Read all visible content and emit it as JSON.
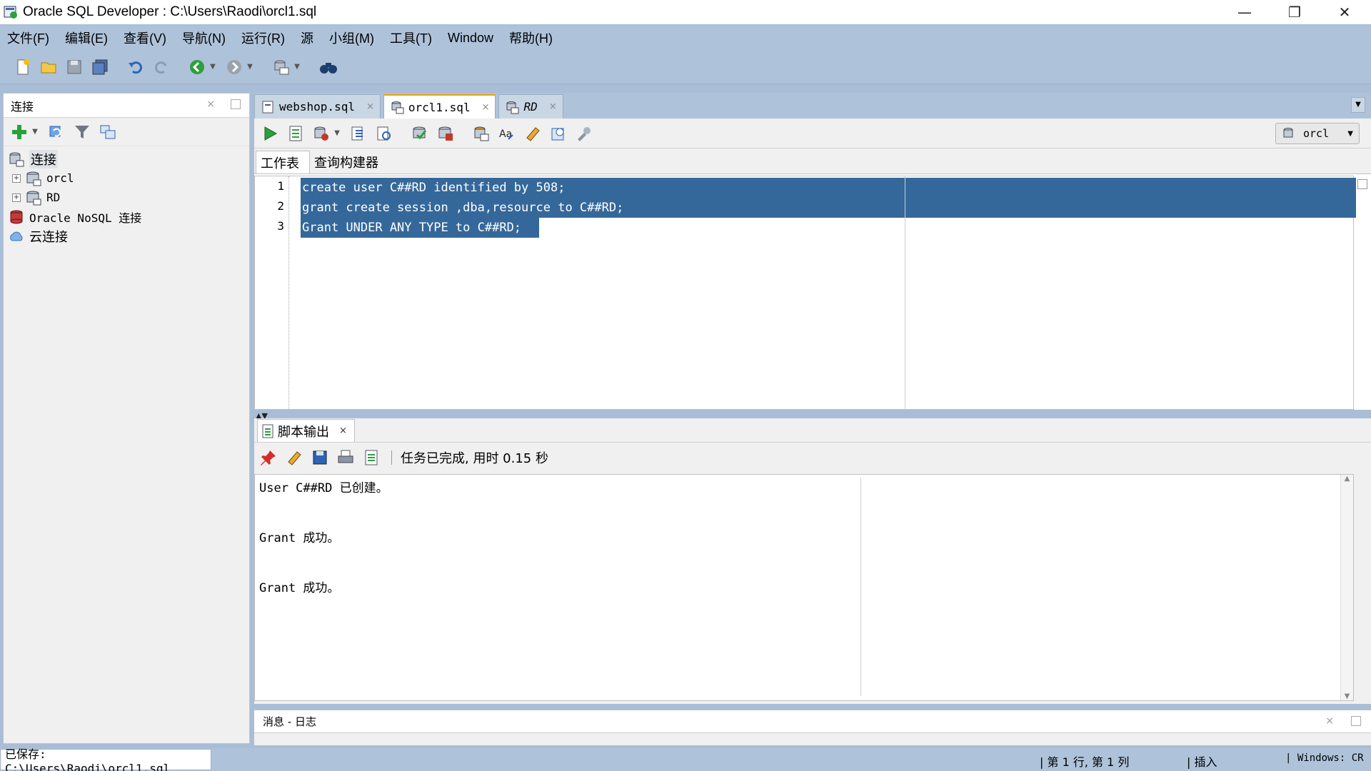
{
  "window": {
    "title": "Oracle SQL Developer : C:\\Users\\Raodi\\orcl1.sql",
    "min": "—",
    "max": "❐",
    "close": "✕"
  },
  "menu": [
    "文件(F)",
    "编辑(E)",
    "查看(V)",
    "导航(N)",
    "运行(R)",
    "源",
    "小组(M)",
    "工具(T)",
    "Window",
    "帮助(H)"
  ],
  "connections_panel": {
    "title": "连接",
    "close": "×",
    "tree": {
      "root": "连接",
      "children": [
        "orcl",
        "RD"
      ],
      "nosql": "Oracle NoSQL 连接",
      "cloud": "云连接"
    }
  },
  "editor": {
    "tabs": [
      {
        "label": "webshop.sql",
        "close": "×"
      },
      {
        "label": "orcl1.sql",
        "close": "×",
        "active": true
      },
      {
        "label": "RD",
        "close": "×"
      }
    ],
    "connection_selector": "orcl",
    "subtabs": [
      "工作表",
      "查询构建器"
    ],
    "lines": [
      {
        "num": "1",
        "text": "create user C##RD identified by 508;"
      },
      {
        "num": "2",
        "text": "grant create session ,dba,resource to C##RD;"
      },
      {
        "num": "3",
        "text": "Grant UNDER ANY TYPE to C##RD;"
      }
    ]
  },
  "output": {
    "tab_label": "脚本输出",
    "tab_close": "×",
    "status": "任务已完成, 用时 0.15 秒",
    "lines": [
      "User C##RD 已创建。",
      "Grant 成功。",
      "Grant 成功。"
    ]
  },
  "messages_log": {
    "title": "消息 - 日志",
    "close": "×"
  },
  "statusbar": {
    "saved": "已保存: C:\\Users\\Raodi\\orcl1.sql",
    "position": "第 1 行, 第 1 列",
    "mode": "插入",
    "line_ending": "Windows: CR"
  },
  "colors": {
    "chrome": "#aec3da",
    "selection": "#35689a",
    "active_tab_accent": "#f0a500"
  }
}
